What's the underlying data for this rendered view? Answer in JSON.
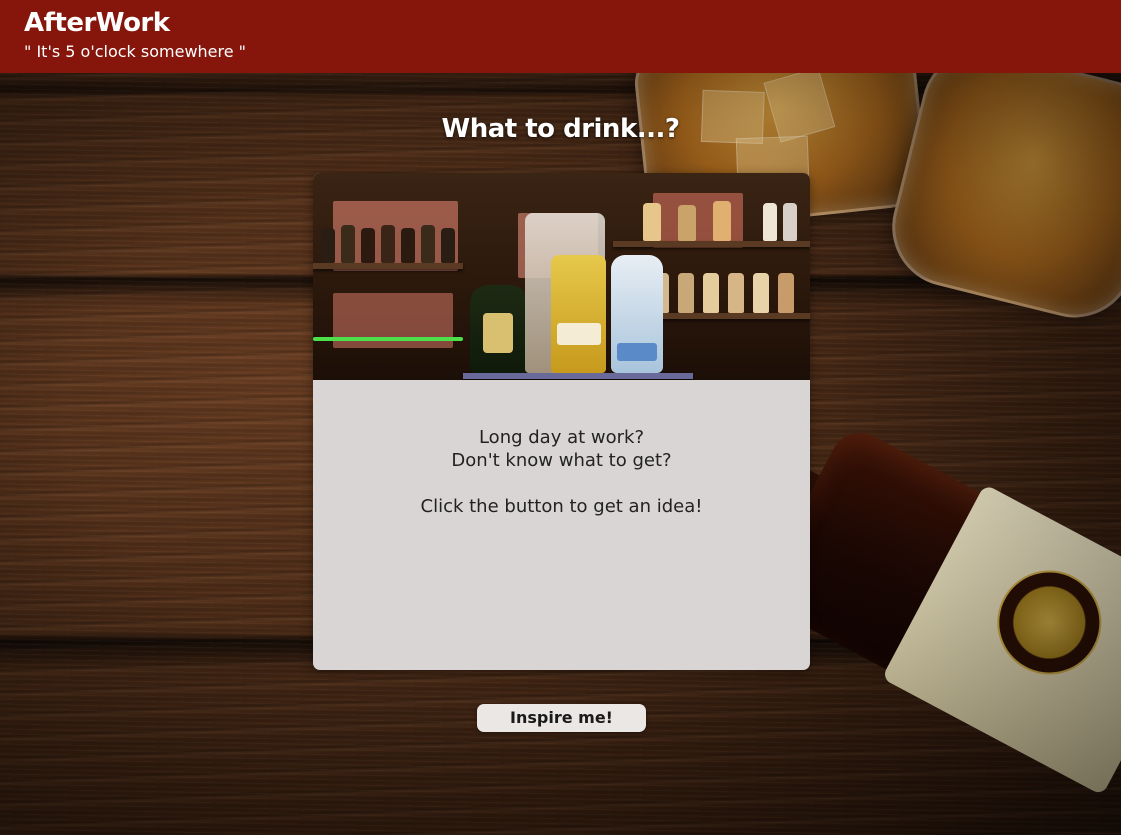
{
  "header": {
    "brand": "AfterWork",
    "tagline": "\" It's 5 o'clock somewhere \""
  },
  "main": {
    "title": "What to drink...?",
    "card": {
      "line1": "Long day at work?",
      "line2": "Don't know what to get?",
      "line3": "Click the button to get an idea!"
    },
    "button_label": "Inspire me!"
  },
  "colors": {
    "header_bg": "#86160c",
    "card_bg": "#d9d5d4",
    "button_bg": "#ebe7e5"
  }
}
